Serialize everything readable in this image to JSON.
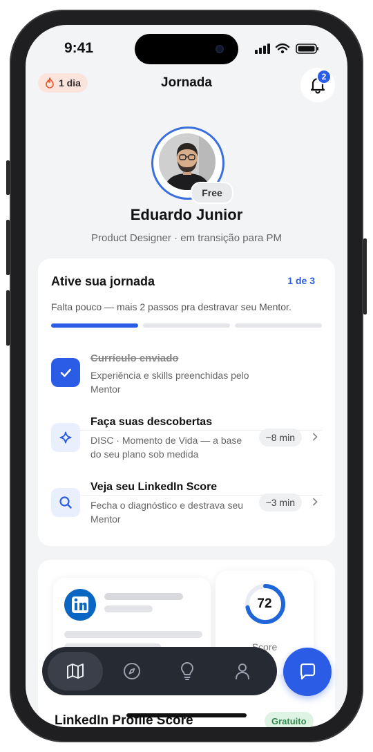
{
  "status": {
    "time": "9:41"
  },
  "header": {
    "streak": "1 dia",
    "title": "Jornada",
    "notifications": "2"
  },
  "profile": {
    "plan_badge": "Free",
    "name": "Eduardo Junior",
    "role": "Product Designer · em transição para PM"
  },
  "journey": {
    "title": "Ative sua jornada",
    "progress": "1 de 3",
    "subtitle": "Falta pouco — mais 2 passos pra destravar seu Mentor.",
    "completed_steps": 1,
    "total_steps": 3,
    "steps": [
      {
        "title": "Currículo enviado",
        "description": "Experiência e skills preenchidas pelo Mentor",
        "done": true,
        "icon": "check-icon"
      },
      {
        "title": "Faça suas descobertas",
        "description": "DISC · Momento de Vida — a base do seu plano sob medida",
        "time": "~8 min",
        "done": false,
        "icon": "sparkle-icon"
      },
      {
        "title": "Veja seu LinkedIn Score",
        "description": "Fecha o diagnóstico e destrava seu Mentor",
        "time": "~3 min",
        "done": false,
        "icon": "search-icon"
      }
    ]
  },
  "linkedin": {
    "score": "72",
    "score_label": "Score",
    "title": "LinkedIn Profile Score",
    "badge": "Gratuito"
  },
  "nav": {
    "items": [
      "map-icon",
      "compass-icon",
      "lightbulb-icon",
      "user-icon"
    ],
    "active": "map-icon"
  },
  "colors": {
    "accent": "#2b5ce6",
    "streak_bg": "#fbe4dc",
    "nav_bg": "#262a33",
    "success_bg": "#dff3e4"
  }
}
